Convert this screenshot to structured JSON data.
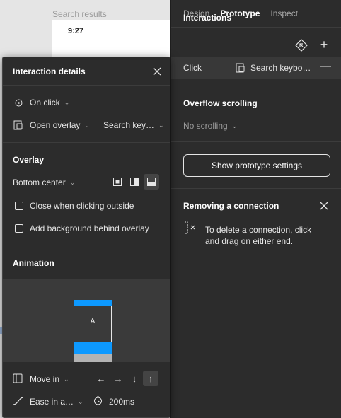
{
  "canvas": {
    "search_label": "Search results",
    "frame_time": "9:27"
  },
  "tabs": [
    {
      "label": "Design",
      "active": false
    },
    {
      "label": "Prototype",
      "active": true
    },
    {
      "label": "Inspect",
      "active": false
    }
  ],
  "interactions": {
    "title": "Interactions",
    "trigger": "Click",
    "destination": "Search keybo…"
  },
  "overflow": {
    "title": "Overflow scrolling",
    "value": "No scrolling"
  },
  "prototype_settings_label": "Show prototype settings",
  "removing": {
    "title": "Removing a connection",
    "line1": "To delete a connection, click",
    "line2": "and drag on either end."
  },
  "dialog": {
    "title": "Interaction details",
    "trigger": "On click",
    "action": "Open overlay",
    "destination": "Search key…",
    "overlay_title": "Overlay",
    "position": "Bottom center",
    "close_outside": "Close when clicking outside",
    "add_background": "Add background behind overlay",
    "animation_title": "Animation",
    "preview_label": "A",
    "animation_type": "Move in",
    "easing": "Ease in a…",
    "duration": "200ms",
    "accent_color": "#0d99ff"
  }
}
